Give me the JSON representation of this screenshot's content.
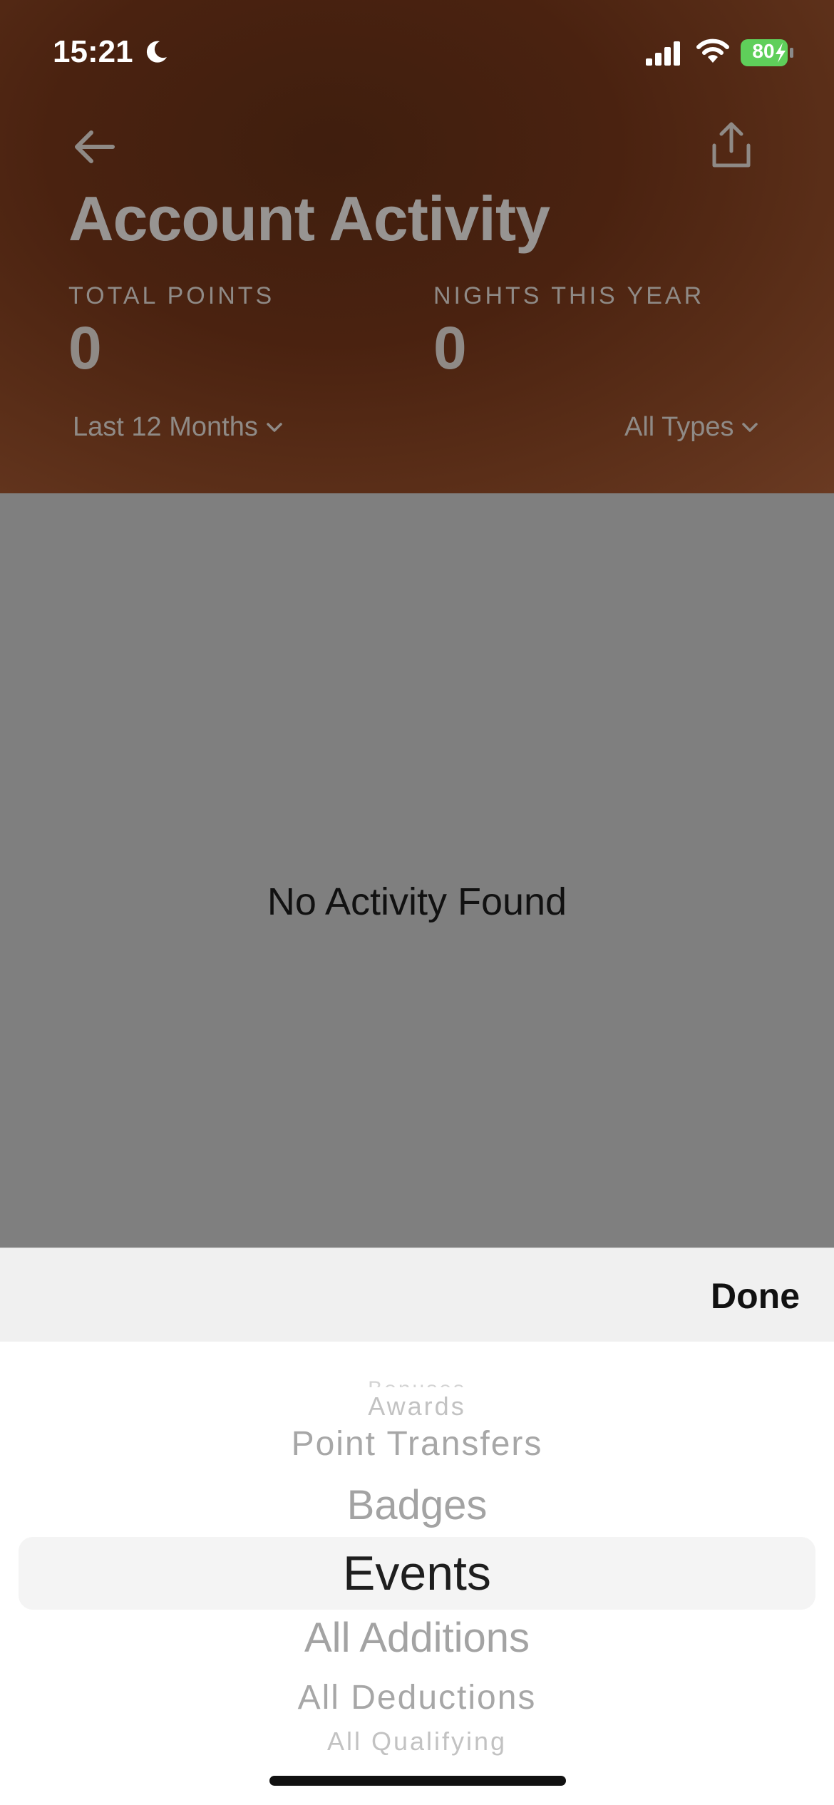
{
  "status": {
    "time": "15:21",
    "battery": "80",
    "icons": [
      "moon-icon",
      "cellular-signal-icon",
      "wifi-icon",
      "battery-charging-icon"
    ]
  },
  "header": {
    "title": "Account Activity",
    "total_points_label": "TOTAL POINTS",
    "total_points_value": "0",
    "nights_label": "NIGHTS THIS YEAR",
    "nights_value": "0",
    "date_filter": "Last 12 Months",
    "type_filter": "All Types"
  },
  "main": {
    "empty_message": "No Activity Found"
  },
  "toolbar": {
    "done_label": "Done"
  },
  "picker": {
    "options": [
      "Bonuses",
      "Awards",
      "Point Transfers",
      "Badges",
      "Events",
      "All Additions",
      "All Deductions",
      "All Qualifying"
    ],
    "selected": "Events"
  },
  "colors": {
    "header_bg": "#4a2210",
    "overlay": "#7f7f7f",
    "battery_green": "#5fcf5a"
  }
}
